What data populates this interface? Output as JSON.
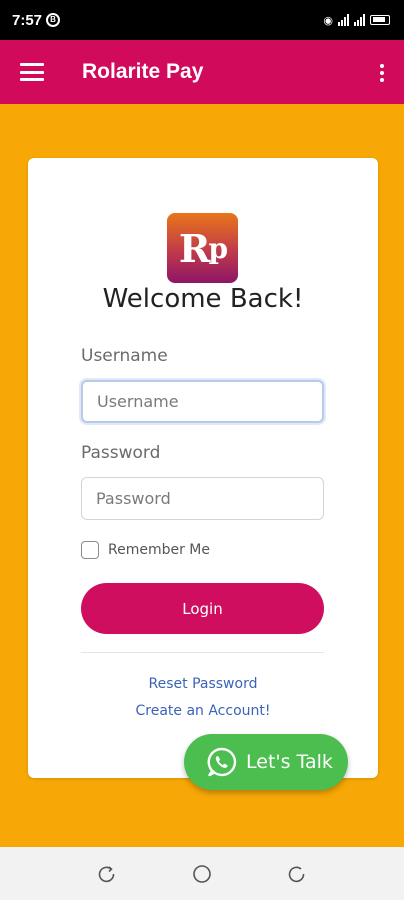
{
  "status_bar": {
    "time": "7:57",
    "notif_badge": "B"
  },
  "app_bar": {
    "title": "Rolarite Pay"
  },
  "card": {
    "logo_text": "R",
    "logo_text_small": "p",
    "welcome": "Welcome Back!",
    "username": {
      "label": "Username",
      "placeholder": "Username",
      "value": ""
    },
    "password": {
      "label": "Password",
      "placeholder": "Password",
      "value": ""
    },
    "remember_label": "Remember Me",
    "login_label": "Login",
    "reset_link": "Reset Password",
    "create_link": "Create an Account!"
  },
  "chat": {
    "label": "Let's Talk",
    "icon": "whatsapp-icon"
  },
  "colors": {
    "background": "#f7a806",
    "app_bar": "#d10a5b",
    "button": "#cf0e60",
    "chat": "#4cbe50",
    "link": "#3b63b7"
  }
}
